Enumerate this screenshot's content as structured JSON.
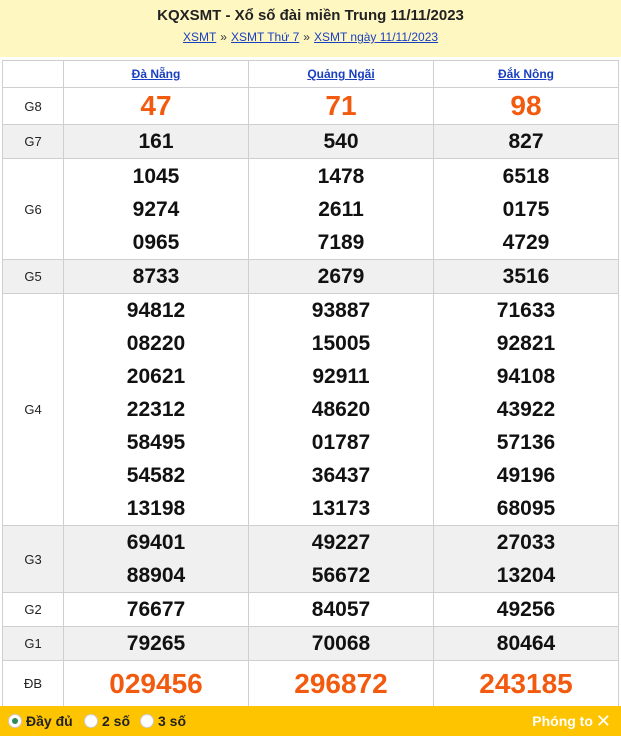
{
  "header": {
    "title": "KQXSMT - Xổ số đài miền Trung 11/11/2023",
    "crumbs": [
      "XSMT",
      "XSMT Thứ 7",
      "XSMT ngày 11/11/2023"
    ],
    "separator": "»"
  },
  "provinces": [
    "Đà Nẵng",
    "Quảng Ngãi",
    "Đắk Nông"
  ],
  "prizes": [
    {
      "label": "G8",
      "style": "big",
      "values": [
        [
          "47"
        ],
        [
          "71"
        ],
        [
          "98"
        ]
      ]
    },
    {
      "label": "G7",
      "style": "num",
      "values": [
        [
          "161"
        ],
        [
          "540"
        ],
        [
          "827"
        ]
      ]
    },
    {
      "label": "G6",
      "style": "num",
      "values": [
        [
          "1045",
          "9274",
          "0965"
        ],
        [
          "1478",
          "2611",
          "7189"
        ],
        [
          "6518",
          "0175",
          "4729"
        ]
      ]
    },
    {
      "label": "G5",
      "style": "num",
      "values": [
        [
          "8733"
        ],
        [
          "2679"
        ],
        [
          "3516"
        ]
      ]
    },
    {
      "label": "G4",
      "style": "num",
      "values": [
        [
          "94812",
          "08220",
          "20621",
          "22312",
          "58495",
          "54582",
          "13198"
        ],
        [
          "93887",
          "15005",
          "92911",
          "48620",
          "01787",
          "36437",
          "13173"
        ],
        [
          "71633",
          "92821",
          "94108",
          "43922",
          "57136",
          "49196",
          "68095"
        ]
      ]
    },
    {
      "label": "G3",
      "style": "num",
      "values": [
        [
          "69401",
          "88904"
        ],
        [
          "49227",
          "56672"
        ],
        [
          "27033",
          "13204"
        ]
      ]
    },
    {
      "label": "G2",
      "style": "num",
      "values": [
        [
          "76677"
        ],
        [
          "84057"
        ],
        [
          "49256"
        ]
      ]
    },
    {
      "label": "G1",
      "style": "num",
      "values": [
        [
          "79265"
        ],
        [
          "70068"
        ],
        [
          "80464"
        ]
      ]
    },
    {
      "label": "ĐB",
      "style": "big",
      "values": [
        [
          "029456"
        ],
        [
          "296872"
        ],
        [
          "243185"
        ]
      ]
    }
  ],
  "footer": {
    "options": [
      "Đầy đủ",
      "2 số",
      "3 số"
    ],
    "selected": 0,
    "zoom_label": "Phóng to"
  },
  "colors": {
    "accent": "#f25b0f",
    "footer_bg": "#ffc400",
    "header_bg": "#fff7c2",
    "link": "#1a3fc0"
  }
}
